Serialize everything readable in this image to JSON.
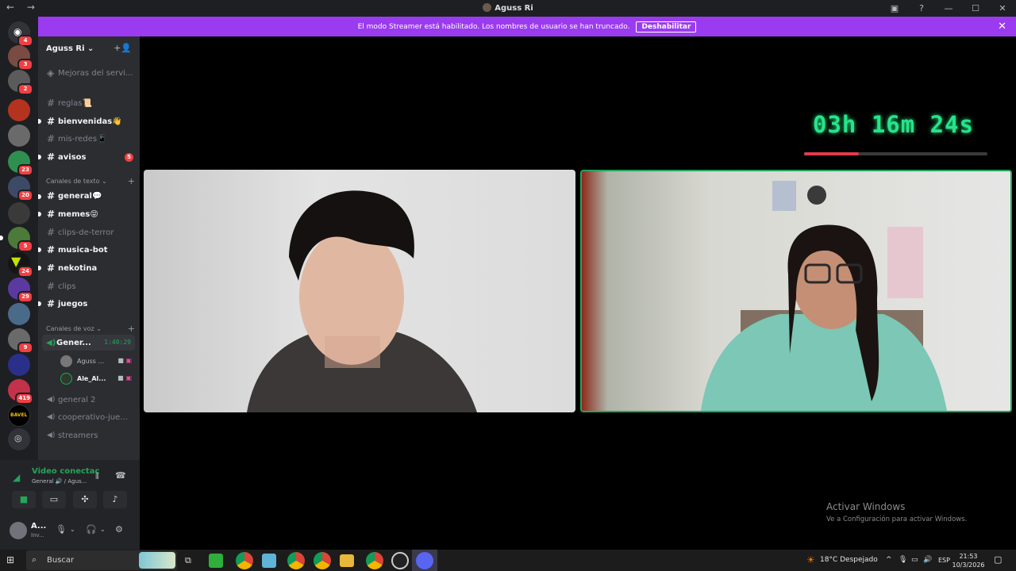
{
  "window": {
    "title": "Aguss Ri",
    "nav": "← →",
    "controls": [
      "▣",
      "?",
      "—",
      "☐",
      "✕"
    ]
  },
  "banner": {
    "message": "El modo Streamer está habilitado. Los nombres de usuario se han truncado.",
    "button_label": "Deshabilitar",
    "close": "✕"
  },
  "servers": {
    "badges": [
      "4",
      "3",
      "2",
      "",
      "",
      "23",
      "20",
      "",
      "5",
      "24",
      "29",
      "",
      "9",
      "",
      "419",
      "",
      ""
    ]
  },
  "guild": {
    "name": "Aguss Ri ⌄",
    "invite_icon": "+👤",
    "boost_item": "Mejoras del servi..."
  },
  "channels_top": [
    {
      "name": "reglas📜",
      "unread": false,
      "badge": ""
    },
    {
      "name": "bienvenidas👋",
      "unread": true,
      "badge": ""
    },
    {
      "name": "mis-redes📱",
      "unread": false,
      "badge": ""
    },
    {
      "name": "avisos",
      "unread": true,
      "badge": "5"
    }
  ],
  "text_category": {
    "label": "Canales de texto ⌄",
    "plus": "+"
  },
  "text_channels": [
    {
      "name": "general💬",
      "unread": true
    },
    {
      "name": "memes😝",
      "unread": true
    },
    {
      "name": "clips-de-terror",
      "unread": false
    },
    {
      "name": "musica-bot",
      "unread": true
    },
    {
      "name": "nekotina",
      "unread": true
    },
    {
      "name": "clips",
      "unread": false
    },
    {
      "name": "juegos",
      "unread": true
    }
  ],
  "voice_category": {
    "label": "Canales de voz ⌄",
    "plus": "+"
  },
  "voice_active": {
    "name": "Gener...",
    "timer": "1:40:29"
  },
  "voice_users": [
    {
      "name": "Aguss ...",
      "bold": false
    },
    {
      "name": "Ale_Al...",
      "bold": true
    }
  ],
  "voice_channels": [
    "general 2",
    "cooperativo-jue...",
    "streamers"
  ],
  "panel": {
    "status": "Video conectac",
    "sub": "General 🔊 / Agus..."
  },
  "user": {
    "name": "A...",
    "status": "Inv..."
  },
  "stage": {
    "timer": "03h 16m 24s",
    "timer_progress": 0.3
  },
  "watermark": {
    "line1": "Activar Windows",
    "line2": "Ve a Configuración para activar Windows."
  },
  "taskbar": {
    "search_placeholder": "Buscar",
    "weather": "18°C  Despejado",
    "lang": "ESP",
    "time": "21:53",
    "date": "10/3/2026"
  },
  "colors": {
    "accent": "#9b3bf0",
    "connected": "#23a55a",
    "badge": "#f23f43",
    "timer": "#27e38a"
  }
}
